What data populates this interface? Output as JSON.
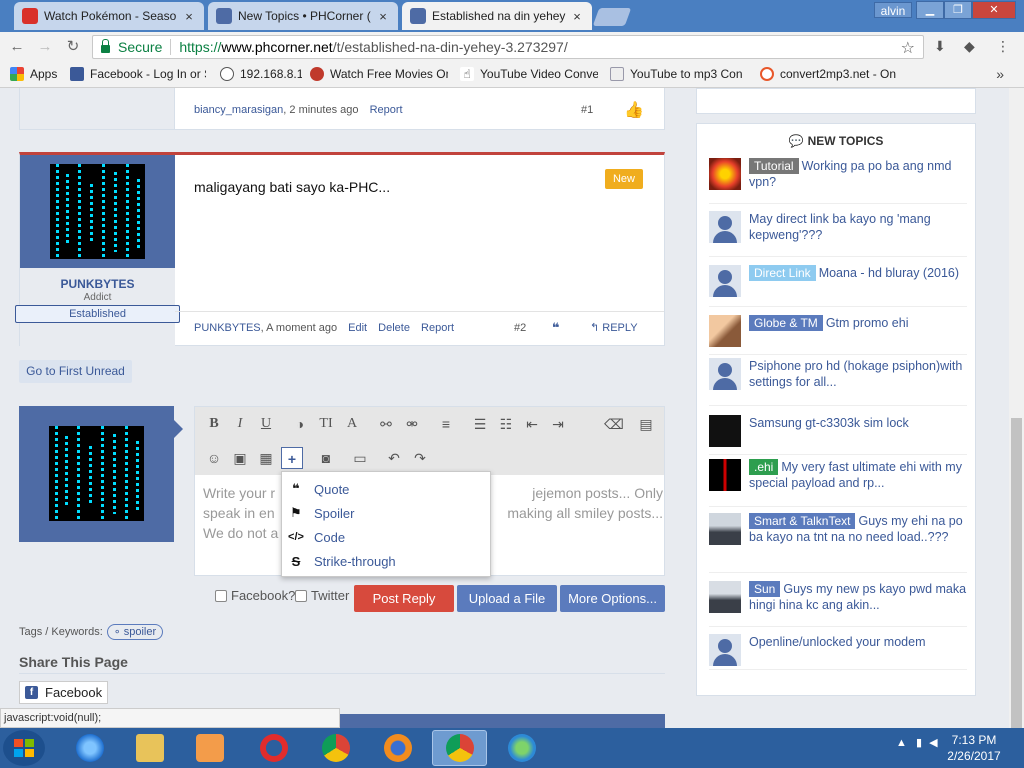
{
  "browser": {
    "tabs": [
      {
        "title": "Watch Pokémon - Seaso",
        "close": "×",
        "active": false
      },
      {
        "title": "New Topics • PHCorner (",
        "close": "×",
        "active": false
      },
      {
        "title": "Established na din yehey",
        "close": "×",
        "active": true
      }
    ],
    "user": "alvin",
    "secure_label": "Secure",
    "url": {
      "scheme": "https://",
      "host": "www.phcorner.net",
      "path": "/t/established-na-din-yehey-3.273297/"
    },
    "bookmarks": [
      "Apps",
      "Facebook - Log In or S",
      "192.168.8.1",
      "Watch Free Movies On",
      "YouTube Video Conve",
      "YouTube to mp3 Con",
      "convert2mp3.net - On"
    ]
  },
  "post1": {
    "author": "biancy_marasigan",
    "time": ", 2 minutes ago",
    "report": "Report",
    "number": "#1"
  },
  "post2": {
    "username": "PUNKBYTES",
    "user_title": "Addict",
    "banner": "Established",
    "message": "maligayang bati sayo ka-PHC...",
    "badge": "New",
    "author": "PUNKBYTES",
    "time": ", A moment ago",
    "actions": {
      "edit": "Edit",
      "delete": "Delete",
      "report": "Report"
    },
    "number": "#2",
    "reply": "REPLY"
  },
  "go_first_unread": "Go to First Unread",
  "editor": {
    "placeholder": "Write your reply... Please don't post spam or jejemon posts... Only speak in english or tagalog... Please avoid making all smiley posts... We do not allow...",
    "placeholder_lines": [
      "Write your r",
      "speak in en",
      "We do not a"
    ],
    "placeholder_right": [
      "jejemon posts... Only",
      "making all smiley posts...",
      ""
    ],
    "insert_menu": [
      {
        "icon": "quote-icon",
        "label": "Quote"
      },
      {
        "icon": "flag-icon",
        "label": "Spoiler"
      },
      {
        "icon": "code-icon",
        "label": "Code"
      },
      {
        "icon": "strikethrough-icon",
        "label": "Strike-through"
      }
    ]
  },
  "reply_options": {
    "facebook": "Facebook?",
    "twitter": "Twitter",
    "post_reply": "Post Reply",
    "upload": "Upload a File",
    "more": "More Options..."
  },
  "tags": {
    "label": "Tags / Keywords:",
    "items": [
      "spoiler"
    ]
  },
  "share": {
    "title": "Share This Page",
    "facebook": "Facebook"
  },
  "status_url": "javascript:void(null);",
  "sidebar": {
    "title": "NEW TOPICS",
    "topics": [
      {
        "prefix": "Tutorial",
        "prefix_color": "#777777",
        "text": "Working pa po ba ang nmd vpn?"
      },
      {
        "prefix": "",
        "prefix_color": "",
        "text": "May direct link ba kayo ng 'mang kepweng'???"
      },
      {
        "prefix": "Direct Link",
        "prefix_color": "#8ecbf0",
        "text": "Moana - hd bluray (2016)"
      },
      {
        "prefix": "Globe & TM",
        "prefix_color": "#5b7bbd",
        "text": "Gtm promo ehi"
      },
      {
        "prefix": "",
        "prefix_color": "",
        "text": "Psiphone pro hd (hokage psiphon)with settings for all..."
      },
      {
        "prefix": "",
        "prefix_color": "",
        "text": "Samsung gt-c3303k sim lock"
      },
      {
        "prefix": ".ehi",
        "prefix_color": "#2e9e4f",
        "text": "My very fast ultimate ehi with my special payload and rp..."
      },
      {
        "prefix": "Smart & TalknText",
        "prefix_color": "#5b7bbd",
        "text": "Guys my ehi na po ba kayo na tnt na no need load..???"
      },
      {
        "prefix": "Sun",
        "prefix_color": "#5b7bbd",
        "text": "Guys my new ps kayo pwd maka hingi hina kc ang akin..."
      },
      {
        "prefix": "",
        "prefix_color": "",
        "text": "Openline/unlocked your modem"
      }
    ]
  },
  "taskbar": {
    "time": "7:13 PM",
    "date": "2/26/2017"
  },
  "colors": {
    "accent": "#3b5998",
    "post_reply": "#d74a3d",
    "button_blue": "#5b7bbd",
    "badge": "#f0ad1e"
  }
}
